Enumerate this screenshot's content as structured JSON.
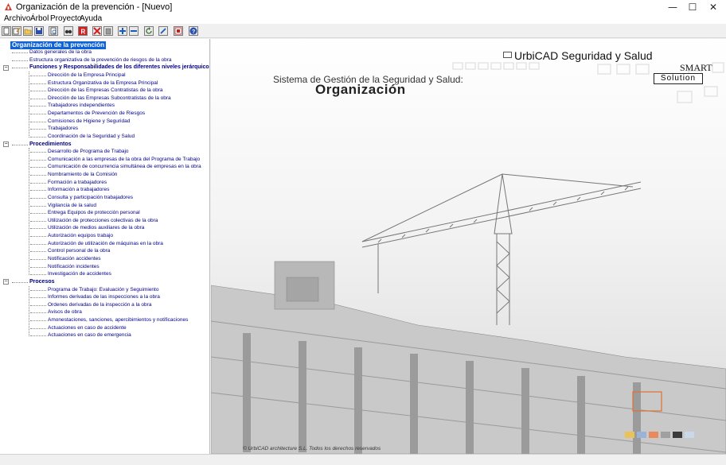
{
  "window": {
    "title": "Organización de la prevención - [Nuevo]",
    "minimize_glyph": "—",
    "maximize_glyph": "☐",
    "close_glyph": "✕"
  },
  "menu": [
    "Archivo",
    "Árbol",
    "Proyecto",
    "Ayuda"
  ],
  "toolbar": {
    "icons": [
      "new-doc-icon",
      "edit-doc-icon",
      "open-folder-icon",
      "save-icon",
      "preview-icon",
      "binoculars-icon",
      "report-icon",
      "delete-icon",
      "trash-icon",
      "add-icon",
      "remove-icon",
      "refresh-icon",
      "edit-icon",
      "print-report-icon",
      "help-icon"
    ]
  },
  "tree": {
    "root": "Organización de la prevención",
    "top_items": [
      "Datos generales de la obra",
      "Estructura organizativa de la prevención de riesgos de la obra"
    ],
    "groups": [
      {
        "label": "Funciones y Responsabilidades de los diferentes niveles jerárquicos",
        "items": [
          "Dirección de la Empresa Principal",
          "Estructura Organizativa de la Empresa Principal",
          "Dirección de las Empresas Contratistas de la obra",
          "Dirección de las Empresas Subcontratistas de la obra",
          "Trabajadores independientes",
          "Departamentos de Prevención de Riesgos",
          "Comisiones de Higiene y Seguridad",
          "Trabajadores",
          "Coordinación de la Seguridad y Salud"
        ]
      },
      {
        "label": "Procedimientos",
        "items": [
          "Desarrollo de Programa de Trabajo",
          "Comunicación a las empresas de la obra del Programa de Trabajo",
          "Comunicación de concurrencia simultánea de empresas en la obra",
          "Nombramiento de la Comisión",
          "Formación a trabajadores",
          "Información a trabajadores",
          "Consulta y participación trabajadores",
          "Vigilancia de la salud",
          "Entrega Equipos de protección personal",
          "Utilización de protecciones colectivas de la obra",
          "Utilización de medios auxiliares de la obra",
          "Autorización equipos trabajo",
          "Autorización de utilización de máquinas en la obra",
          "Control personal de la obra",
          "Notificación accidentes",
          "Notificación incidentes",
          "Investigación de accidentes"
        ]
      },
      {
        "label": "Procesos",
        "items": [
          "Programa de Trabajo: Evaluación y Seguimiento",
          "Informes derivadas de las inspecciones a la obra",
          "Ordenes derivadas de la inspección a la obra",
          "Avisos de obra",
          "Amonestaciones, sanciones, apercibimientos y notificaciones",
          "Actuaciones en caso de accidente",
          "Actuaciones en caso de emergencia"
        ]
      }
    ]
  },
  "splash": {
    "brand": "UrbiCAD Seguridad y Salud",
    "smart": "SMART",
    "solution": "Solution",
    "subtitle": "Sistema de Gestión de la Seguridad y Salud:",
    "heading": "Organización",
    "copyright": "©  UrbiCAD architecture S.L. Todos los derechos reservados",
    "swatches": [
      "#e9c25a",
      "#9ab3d6",
      "#e88a5c",
      "#a0a0a0",
      "#3a3a3a",
      "#c9d9e9"
    ]
  }
}
